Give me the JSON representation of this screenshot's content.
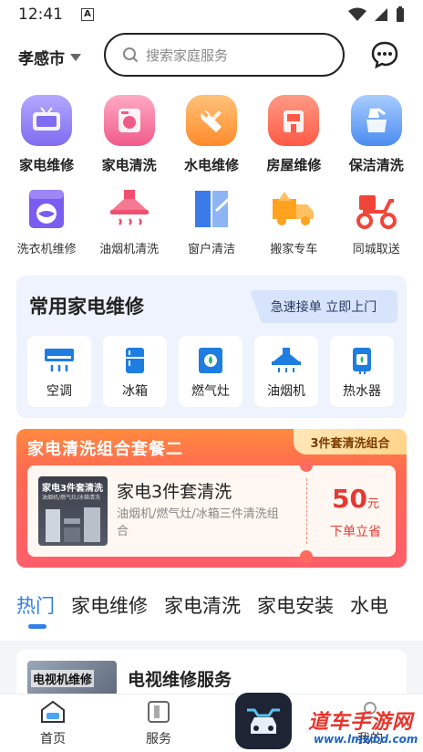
{
  "status": {
    "time": "12:41",
    "a_indicator": "A"
  },
  "header": {
    "city": "孝感市",
    "search_placeholder": "搜索家庭服务"
  },
  "icons_row1": [
    {
      "label": "家电维修",
      "icon": "tv-repair-icon",
      "color": "#7f6cf0"
    },
    {
      "label": "家电清洗",
      "icon": "washer-clean-icon",
      "color": "#f05b8a"
    },
    {
      "label": "水电维修",
      "icon": "wrench-icon",
      "color": "#ff8a2a"
    },
    {
      "label": "房屋维修",
      "icon": "house-repair-icon",
      "color": "#ff5a45"
    },
    {
      "label": "保洁清洗",
      "icon": "cleaning-icon",
      "color": "#4a8cf0"
    }
  ],
  "icons_row2": [
    {
      "label": "洗衣机维修",
      "icon": "washing-machine-icon",
      "color": "#7b5cf0"
    },
    {
      "label": "油烟机清洗",
      "icon": "range-hood-icon",
      "color": "#f0506e"
    },
    {
      "label": "窗户清洁",
      "icon": "window-icon",
      "color": "#3a7be8"
    },
    {
      "label": "搬家专车",
      "icon": "moving-truck-icon",
      "color": "#ffa21e"
    },
    {
      "label": "同城取送",
      "icon": "scooter-icon",
      "color": "#f2453a"
    }
  ],
  "common_repair": {
    "title": "常用家电维修",
    "badge": "急速接单 立即上门",
    "items": [
      {
        "label": "空调",
        "icon": "air-conditioner-icon"
      },
      {
        "label": "冰箱",
        "icon": "fridge-icon"
      },
      {
        "label": "燃气灶",
        "icon": "gas-stove-icon"
      },
      {
        "label": "油烟机",
        "icon": "range-hood-icon"
      },
      {
        "label": "热水器",
        "icon": "water-heater-icon"
      }
    ]
  },
  "package": {
    "title": "家电清洗组合套餐二",
    "tag": "3件套清洗组合",
    "thumb_title": "家电3件套清洗",
    "thumb_sub": "油烟机/燃气灶/冰箱清洗",
    "name": "家电3件套清洗",
    "desc": "油烟机/燃气灶/冰箱三件清洗组合",
    "price": "50",
    "unit": "元",
    "order": "下单立省"
  },
  "tabs": [
    "热门",
    "家电维修",
    "家电清洗",
    "家电安装",
    "水电"
  ],
  "list": [
    {
      "title": "电视维修服务",
      "thumb_text": "电视机维修"
    }
  ],
  "nav": {
    "home": "首页",
    "service": "服务",
    "mine": "我的"
  },
  "watermark": {
    "text": "道车手游网",
    "url": "www.lmwbd.com"
  },
  "colors": {
    "accent": "#2f7fe8",
    "price": "#e53935"
  }
}
